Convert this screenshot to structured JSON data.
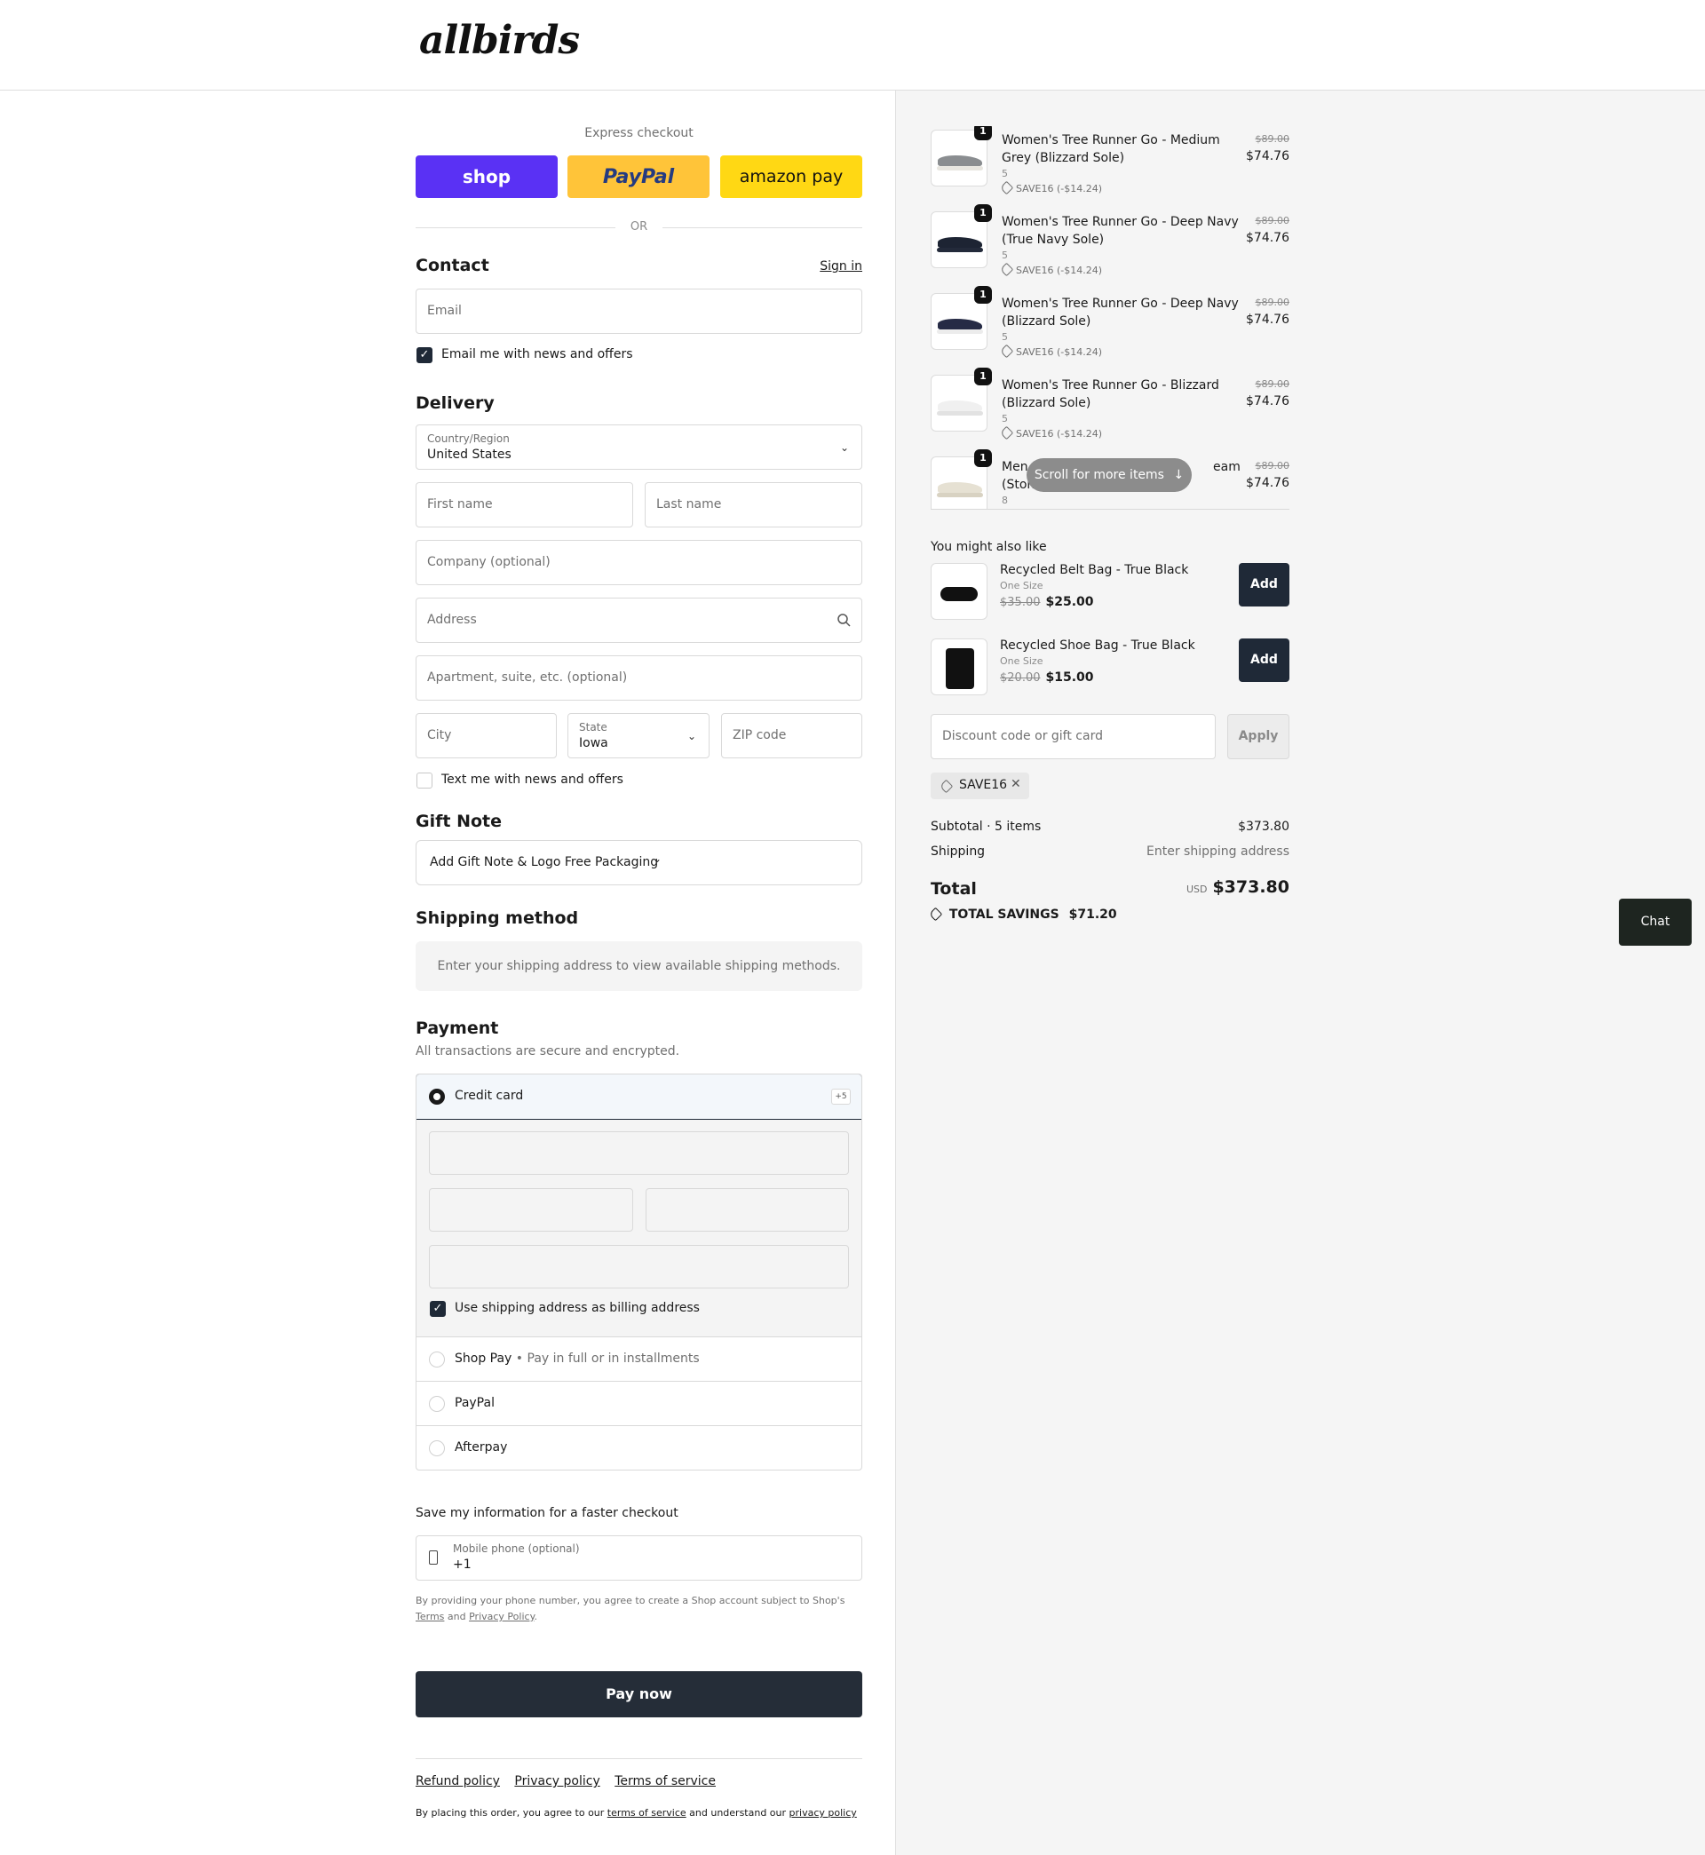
{
  "brand": {
    "logo_text": "allbirds"
  },
  "express": {
    "label": "Express checkout",
    "buttons": [
      "shop",
      "PayPal",
      "amazon pay"
    ],
    "or": "OR"
  },
  "contact": {
    "title": "Contact",
    "sign_in": "Sign in",
    "email_placeholder": "Email",
    "newsletter_label": "Email me with news and offers",
    "newsletter_checked": true
  },
  "delivery": {
    "title": "Delivery",
    "country_label": "Country/Region",
    "country_value": "United States",
    "first_name": "First name",
    "last_name": "Last name",
    "company": "Company (optional)",
    "address": "Address",
    "apartment": "Apartment, suite, etc. (optional)",
    "city": "City",
    "state_label": "State",
    "state_value": "Iowa",
    "zip": "ZIP code",
    "sms_label": "Text me with news and offers",
    "sms_checked": false
  },
  "gift_note": {
    "title": "Gift Note",
    "dropdown": "Add Gift Note & Logo Free Packaging"
  },
  "shipping_method": {
    "title": "Shipping method",
    "placeholder": "Enter your shipping address to view available shipping methods."
  },
  "payment": {
    "title": "Payment",
    "subtitle": "All transactions are secure and encrypted.",
    "credit_card": "Credit card",
    "more_badge": "+5",
    "billing_same": "Use shipping address as billing address",
    "shop_pay": "Shop Pay",
    "shop_pay_sep": "•",
    "shop_pay_note": "Pay in full or in installments",
    "paypal": "PayPal",
    "afterpay": "Afterpay"
  },
  "save_info": {
    "title": "Save my information for a faster checkout",
    "phone_label": "Mobile phone (optional)",
    "phone_value": "+1",
    "legal_1": "By providing your phone number, you agree to create a Shop account subject to Shop's",
    "terms": "Terms",
    "and": "and",
    "privacy": "Privacy Policy",
    "period": "."
  },
  "pay_now": "Pay now",
  "footer": {
    "links": [
      "Refund policy",
      "Privacy policy",
      "Terms of service"
    ],
    "legal_pre": "By placing this order, you agree to our",
    "legal_terms": "terms of service",
    "legal_mid": "and understand our",
    "legal_privacy": "privacy policy"
  },
  "cart": {
    "items": [
      {
        "qty": "1",
        "name": "Women's Tree Runner Go - Medium Grey (Blizzard Sole)",
        "size": "5",
        "discount": "SAVE16 (-$14.24)",
        "original": "$89.00",
        "price": "$74.76",
        "color": "#8a8d90",
        "sole": "#e8e6e0"
      },
      {
        "qty": "1",
        "name": "Women's Tree Runner Go - Deep Navy (True Navy Sole)",
        "size": "5",
        "discount": "SAVE16 (-$14.24)",
        "original": "$89.00",
        "price": "$74.76",
        "color": "#1d2433",
        "sole": "#232a3a"
      },
      {
        "qty": "1",
        "name": "Women's Tree Runner Go - Deep Navy (Blizzard Sole)",
        "size": "5",
        "discount": "SAVE16 (-$14.24)",
        "original": "$89.00",
        "price": "$74.76",
        "color": "#262b45",
        "sole": "#ececec"
      },
      {
        "qty": "1",
        "name": "Women's Tree Runner Go - Blizzard (Blizzard Sole)",
        "size": "5",
        "discount": "SAVE16 (-$14.24)",
        "original": "$89.00",
        "price": "$74.76",
        "color": "#f0f0f0",
        "sole": "#e2e2e2"
      },
      {
        "qty": "1",
        "name_start": "Men",
        "name_end": "eam",
        "name_line2": "(Ston",
        "size": "8",
        "original": "$89.00",
        "price": "$74.76",
        "color": "#e6e1d3",
        "sole": "#d8d2c2"
      }
    ],
    "scroll_hint": "Scroll for more items"
  },
  "recommendations": {
    "title": "You might also like",
    "items": [
      {
        "name": "Recycled Belt Bag - True Black",
        "size": "One Size",
        "original": "$35.00",
        "price": "$25.00",
        "button": "Add"
      },
      {
        "name": "Recycled Shoe Bag - True Black",
        "size": "One Size",
        "original": "$20.00",
        "price": "$15.00",
        "button": "Add"
      }
    ]
  },
  "discount": {
    "placeholder": "Discount code or gift card",
    "apply": "Apply",
    "applied_code": "SAVE16"
  },
  "summary": {
    "subtotal_label": "Subtotal · 5 items",
    "subtotal_value": "$373.80",
    "shipping_label": "Shipping",
    "shipping_value": "Enter shipping address",
    "total_label": "Total",
    "currency": "USD",
    "total_value": "$373.80",
    "savings_label": "TOTAL SAVINGS",
    "savings_value": "$71.20"
  },
  "chat": {
    "label": "Chat"
  }
}
